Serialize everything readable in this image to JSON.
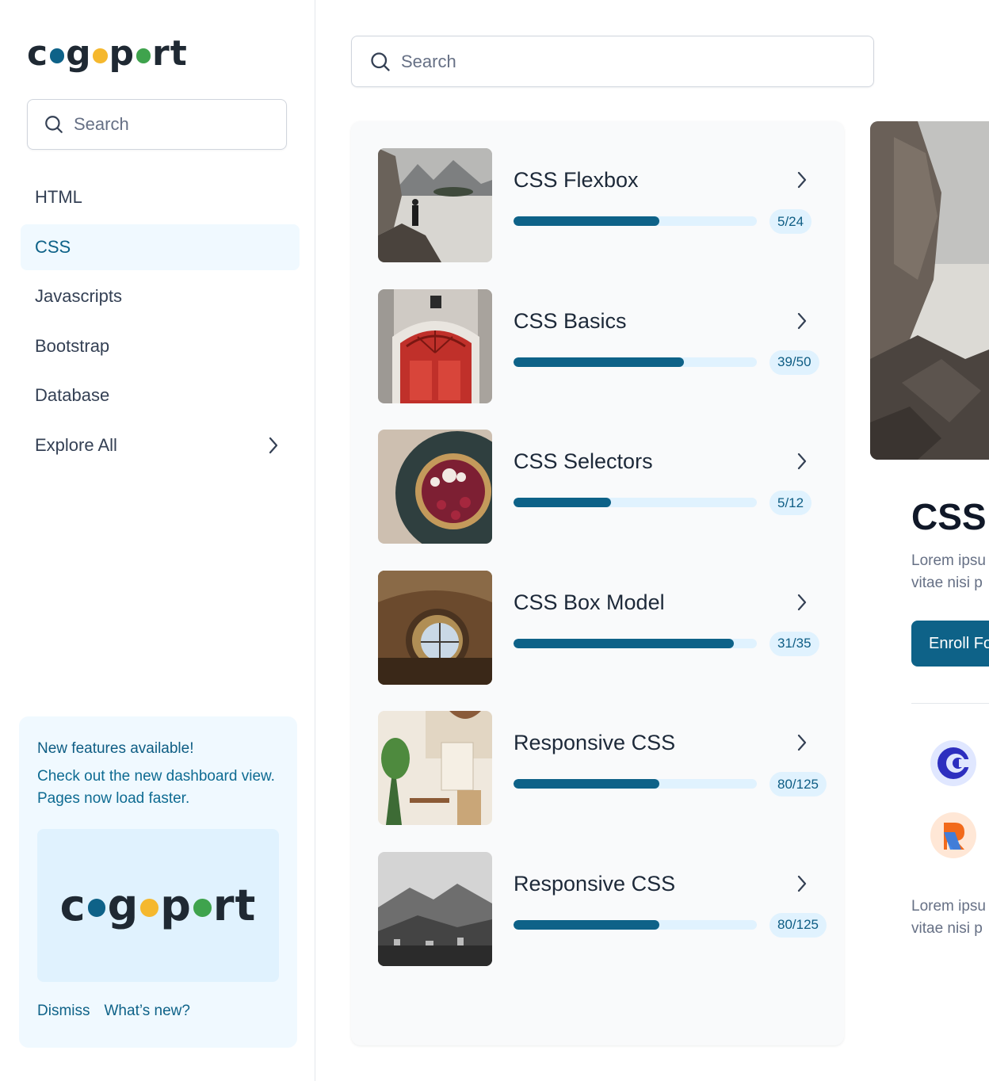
{
  "brand": {
    "letters_before": "c",
    "letters_mid1": "g",
    "letters_mid2": "p",
    "letters_after": "rt",
    "dot_colors": [
      "#0e6288",
      "#f5b82e",
      "#3fa34d"
    ]
  },
  "sidebar": {
    "search": {
      "placeholder": "Search",
      "icon": "search-icon"
    },
    "nav": [
      {
        "label": "HTML"
      },
      {
        "label": "CSS",
        "active": true
      },
      {
        "label": "Javascripts"
      },
      {
        "label": "Bootstrap"
      },
      {
        "label": "Database"
      },
      {
        "label": "Explore All",
        "icon": "chevron-right-icon"
      }
    ],
    "notice": {
      "title": "New features available!",
      "body": "Check out the new dashboard view. Pages now load faster.",
      "dismiss": "Dismiss",
      "whats_new": "What’s new?"
    }
  },
  "main": {
    "search": {
      "placeholder": "Search",
      "icon": "search-icon"
    },
    "courses": [
      {
        "title": "CSS Flexbox",
        "progress": "5/24",
        "fraction": 0.6,
        "thumb": "mountain-lake-photo"
      },
      {
        "title": "CSS Basics",
        "progress": "39/50",
        "fraction": 0.7,
        "thumb": "red-door-photo"
      },
      {
        "title": "CSS Selectors",
        "progress": "5/12",
        "fraction": 0.4,
        "thumb": "berry-tart-photo"
      },
      {
        "title": "CSS Box Model",
        "progress": "31/35",
        "fraction": 0.905,
        "thumb": "round-window-photo"
      },
      {
        "title": "Responsive CSS",
        "progress": "80/125",
        "fraction": 0.6,
        "thumb": "cafe-plants-photo"
      },
      {
        "title": "Responsive CSS",
        "progress": "80/125",
        "fraction": 0.6,
        "thumb": "mountain-town-photo"
      }
    ]
  },
  "detail": {
    "title": "CSS",
    "desc_line1": "Lorem ipsu",
    "desc_line2": "vitae nisi p",
    "enroll": "Enroll Fo",
    "desc2_line1": "Lorem ipsu",
    "desc2_line2": "vitae nisi p",
    "icons": [
      "c-brand-icon",
      "r-brand-icon"
    ]
  },
  "colors": {
    "primary": "#0e6288",
    "primary_light": "#e0f2fe",
    "active_bg": "#f0f9ff"
  }
}
